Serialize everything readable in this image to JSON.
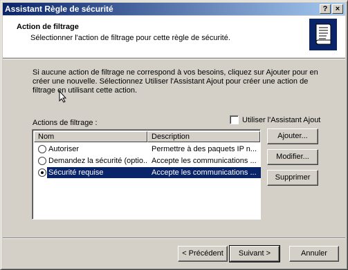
{
  "window": {
    "title": "Assistant Règle de sécurité",
    "help_button": "?",
    "close_button": "×"
  },
  "header": {
    "title": "Action de filtrage",
    "subtitle": "Sélectionner l'action de filtrage pour cette règle de sécurité.",
    "icon": "scroll-document-icon"
  },
  "intro": {
    "text": "Si aucune action de filtrage ne correspond à vos besoins, cliquez sur Ajouter pour en créer une nouvelle. Sélectionnez Utiliser l'Assistant Ajout pour créer une action de filtrage en utilisant cette action."
  },
  "filter_actions": {
    "label": "Actions de filtrage :",
    "use_wizard_label": "Utiliser l'Assistant Ajout",
    "use_wizard_checked": false,
    "columns": [
      "Nom",
      "Description"
    ],
    "rows": [
      {
        "name": "Autoriser",
        "description": "Permettre à des paquets IP n...",
        "selected": false
      },
      {
        "name": "Demandez la sécurité (optio...",
        "description": "Accepte les communications ...",
        "selected": false
      },
      {
        "name": "Sécurité requise",
        "description": "Accepte les communications ...",
        "selected": true
      }
    ]
  },
  "side_buttons": {
    "add": "Ajouter...",
    "modify": "Modifier...",
    "delete": "Supprimer"
  },
  "nav_buttons": {
    "back": "< Précédent",
    "next": "Suivant >",
    "cancel": "Annuler"
  },
  "colors": {
    "selection": "#0a246a",
    "face": "#d4d0c8"
  }
}
